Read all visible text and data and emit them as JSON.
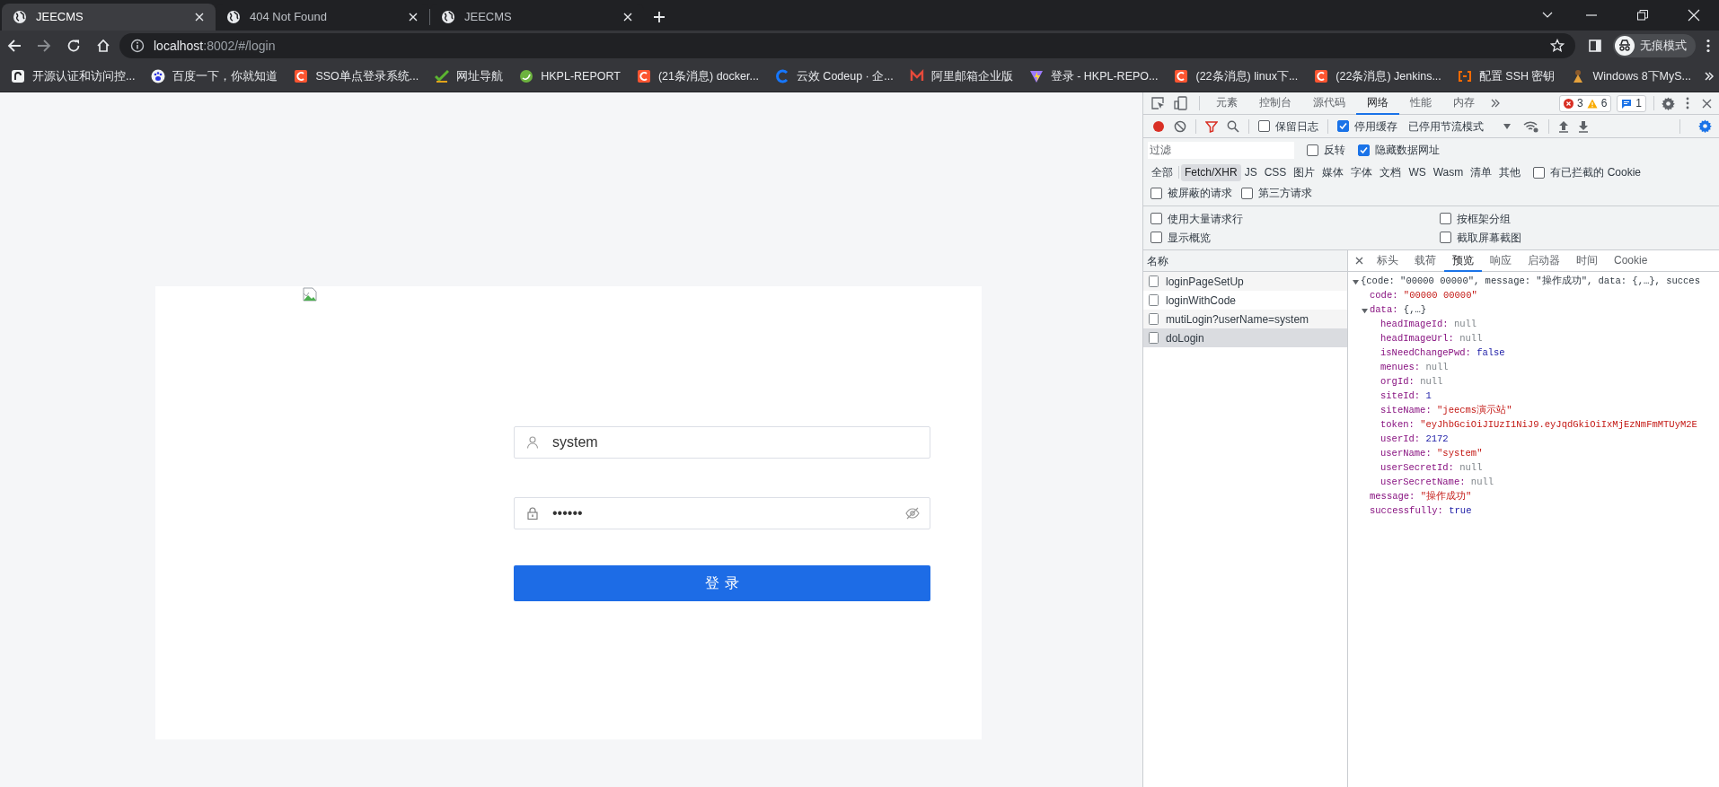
{
  "browser_tabs": [
    {
      "title": "JEECMS",
      "selected": true
    },
    {
      "title": "404 Not Found",
      "selected": false
    },
    {
      "title": "JEECMS",
      "selected": false
    }
  ],
  "address_bar": {
    "host": "localhost",
    "path": ":8002/#/login"
  },
  "profile": {
    "label": "无痕模式"
  },
  "bookmarks": [
    {
      "title": "开源认证和访问控..."
    },
    {
      "title": "百度一下，你就知道"
    },
    {
      "title": "SSO单点登录系统..."
    },
    {
      "title": "网址导航"
    },
    {
      "title": "HKPL-REPORT"
    },
    {
      "title": "(21条消息) docker..."
    },
    {
      "title": "云效 Codeup · 企..."
    },
    {
      "title": "阿里邮箱企业版"
    },
    {
      "title": "登录 - HKPL-REPO..."
    },
    {
      "title": "(22条消息) linux下..."
    },
    {
      "title": "(22条消息) Jenkins..."
    },
    {
      "title": "配置 SSH 密钥"
    },
    {
      "title": "Windows 8下MyS..."
    }
  ],
  "login": {
    "username": {
      "value": "system"
    },
    "password": {
      "value": "••••••"
    },
    "submit": "登录"
  },
  "devtools": {
    "panel_tabs": [
      {
        "label": "元素",
        "selected": false
      },
      {
        "label": "控制台",
        "selected": false
      },
      {
        "label": "源代码",
        "selected": false
      },
      {
        "label": "网络",
        "selected": true
      },
      {
        "label": "性能",
        "selected": false
      },
      {
        "label": "内存",
        "selected": false
      }
    ],
    "issues": {
      "errors": "3",
      "warnings": "6",
      "messages": "1"
    },
    "network_toolbar": {
      "recording": true,
      "options": [
        {
          "label": "保留日志",
          "checked": false
        },
        {
          "label": "停用缓存",
          "checked": true
        }
      ],
      "throttling": "已停用节流模式"
    },
    "filter": {
      "placeholder": "过滤",
      "options": [
        {
          "label": "反转",
          "checked": false
        },
        {
          "label": "隐藏数据网址",
          "checked": true
        }
      ]
    },
    "type_filters": [
      {
        "label": "全部",
        "selected": false
      },
      {
        "label": "Fetch/XHR",
        "selected": true
      },
      {
        "label": "JS",
        "selected": false
      },
      {
        "label": "CSS",
        "selected": false
      },
      {
        "label": "图片",
        "selected": false
      },
      {
        "label": "媒体",
        "selected": false
      },
      {
        "label": "字体",
        "selected": false
      },
      {
        "label": "文档",
        "selected": false
      },
      {
        "label": "WS",
        "selected": false
      },
      {
        "label": "Wasm",
        "selected": false
      },
      {
        "label": "清单",
        "selected": false
      },
      {
        "label": "其他",
        "selected": false
      }
    ],
    "blocked_cookies": {
      "label": "有已拦截的 Cookie",
      "checked": false
    },
    "request_filters": [
      {
        "label": "被屏蔽的请求",
        "checked": false
      },
      {
        "label": "第三方请求",
        "checked": false
      }
    ],
    "settings": [
      {
        "label": "使用大量请求行",
        "checked": false
      },
      {
        "label": "按框架分组",
        "checked": false
      },
      {
        "label": "显示概览",
        "checked": false
      },
      {
        "label": "截取屏幕截图",
        "checked": false
      }
    ],
    "requests": {
      "column": "名称",
      "rows": [
        {
          "name": "loginPageSetUp",
          "selected": false
        },
        {
          "name": "loginWithCode",
          "selected": false
        },
        {
          "name": "mutiLogin?userName=system",
          "selected": false
        },
        {
          "name": "doLogin",
          "selected": true
        }
      ]
    },
    "detail_tabs": [
      {
        "label": "标头",
        "selected": false
      },
      {
        "label": "载荷",
        "selected": false
      },
      {
        "label": "预览",
        "selected": true
      },
      {
        "label": "响应",
        "selected": false
      },
      {
        "label": "启动器",
        "selected": false
      },
      {
        "label": "时间",
        "selected": false
      },
      {
        "label": "Cookie",
        "selected": false
      }
    ],
    "preview": {
      "summary": "{code: \"00000 00000\", message: \"操作成功\", data: {,…}, succes",
      "expanded": true,
      "children": [
        {
          "key": "code:",
          "value": "\"00000 00000\"",
          "kind": "string"
        },
        {
          "key": "data:",
          "value": "{,…}",
          "kind": "object",
          "expanded": true,
          "children": [
            {
              "key": "headImageId:",
              "value": "null",
              "kind": "null"
            },
            {
              "key": "headImageUrl:",
              "value": "null",
              "kind": "null"
            },
            {
              "key": "isNeedChangePwd:",
              "value": "false",
              "kind": "boolean"
            },
            {
              "key": "menues:",
              "value": "null",
              "kind": "null"
            },
            {
              "key": "orgId:",
              "value": "null",
              "kind": "null"
            },
            {
              "key": "siteId:",
              "value": "1",
              "kind": "number"
            },
            {
              "key": "siteName:",
              "value": "\"jeecms演示站\"",
              "kind": "string"
            },
            {
              "key": "token:",
              "value": "\"eyJhbGciOiJIUzI1NiJ9.eyJqdGkiOiIxMjEzNmFmMTUyM2E",
              "kind": "string"
            },
            {
              "key": "userId:",
              "value": "2172",
              "kind": "number"
            },
            {
              "key": "userName:",
              "value": "\"system\"",
              "kind": "string"
            },
            {
              "key": "userSecretId:",
              "value": "null",
              "kind": "null"
            },
            {
              "key": "userSecretName:",
              "value": "null",
              "kind": "null"
            }
          ]
        },
        {
          "key": "message:",
          "value": "\"操作成功\"",
          "kind": "string"
        },
        {
          "key": "successfully:",
          "value": "true",
          "kind": "boolean"
        }
      ]
    }
  }
}
